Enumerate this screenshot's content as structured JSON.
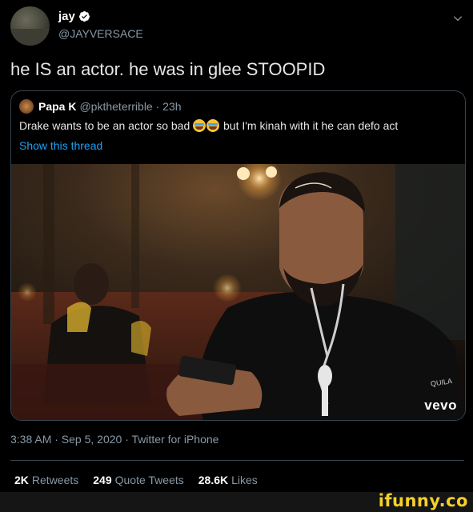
{
  "tweet": {
    "author": {
      "name": "jay",
      "handle": "@JAYVERSACE"
    },
    "text": "he IS an actor. he was in glee STOOPID",
    "timestamp": "3:38 AM · Sep 5, 2020 · Twitter for iPhone",
    "stats": [
      {
        "value": "2K",
        "label": "Retweets"
      },
      {
        "value": "249",
        "label": "Quote Tweets"
      },
      {
        "value": "28.6K",
        "label": "Likes"
      }
    ]
  },
  "quoted": {
    "name": "Papa K",
    "handle_time": "@pktheterrible · 23h",
    "text_before": "Drake wants to be an actor so bad ",
    "text_after": " but I'm kinah with it he can defo act",
    "show_thread": "Show this thread",
    "media": {
      "vevo": "vevo",
      "corner_text": "QUILA"
    }
  },
  "watermark": {
    "text": "ifunny.co"
  },
  "colors": {
    "link": "#1da1f2",
    "verified": "#1da1f2",
    "muted": "#8899a6",
    "border": "#38444d",
    "watermark": "#f5d02a"
  },
  "icons": [
    "verified-badge-icon",
    "chevron-down-icon",
    "emoji-joy-icon"
  ]
}
